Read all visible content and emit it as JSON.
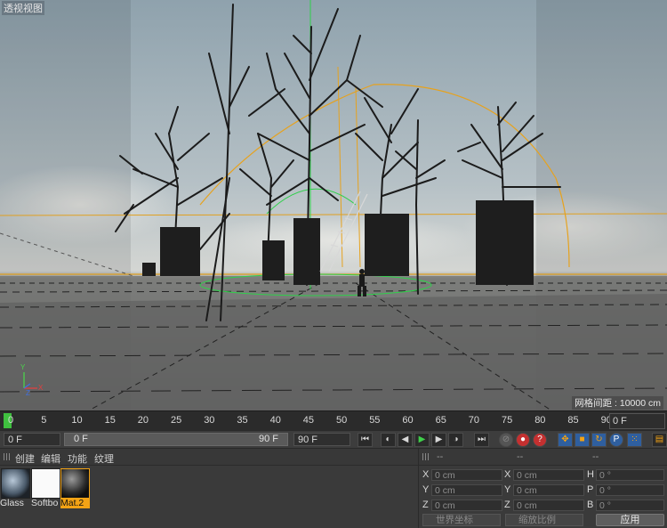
{
  "viewport": {
    "title": "透视视图",
    "grid_info": "网格间距 : 10000 cm",
    "axes": {
      "y": "Y",
      "x": "X",
      "z": "Z"
    }
  },
  "timeline": {
    "ticks": [
      "0",
      "5",
      "10",
      "15",
      "20",
      "25",
      "30",
      "35",
      "40",
      "45",
      "50",
      "55",
      "60",
      "65",
      "70",
      "75",
      "80",
      "85",
      "90"
    ],
    "current_frame": "0 F"
  },
  "transport": {
    "start_frame": "0 F",
    "range_start": "0 F",
    "range_end": "90 F",
    "end_frame": "90 F",
    "buttons": [
      "go-to-start",
      "prev-key",
      "prev-frame",
      "play",
      "next-frame",
      "next-key",
      "go-to-end",
      "record-keys",
      "auto-key",
      "keyframe-selection",
      "move",
      "scale",
      "rotate",
      "param",
      "pla",
      "timeline"
    ]
  },
  "materials": {
    "menu": [
      "创建",
      "编辑",
      "功能",
      "纹理"
    ],
    "items": [
      {
        "label": "Glass",
        "selected": false
      },
      {
        "label": "Softbo",
        "selected": false
      },
      {
        "label": "Mat.2",
        "selected": true
      }
    ],
    "accent": "#f3a315"
  },
  "coordinates": {
    "headers": [
      "--",
      "--",
      "--"
    ],
    "rows": [
      {
        "p_label": "X",
        "p_value": "0 cm",
        "s_label": "X",
        "s_value": "0 cm",
        "r_label": "H",
        "r_value": "0 °"
      },
      {
        "p_label": "Y",
        "p_value": "0 cm",
        "s_label": "Y",
        "s_value": "0 cm",
        "r_label": "P",
        "r_value": "0 °"
      },
      {
        "p_label": "Z",
        "p_value": "0 cm",
        "s_label": "Z",
        "s_value": "0 cm",
        "r_label": "B",
        "r_value": "0 °"
      }
    ],
    "mode_world": "世界坐标",
    "mode_scale": "缩放比例",
    "apply_label": "应用"
  }
}
